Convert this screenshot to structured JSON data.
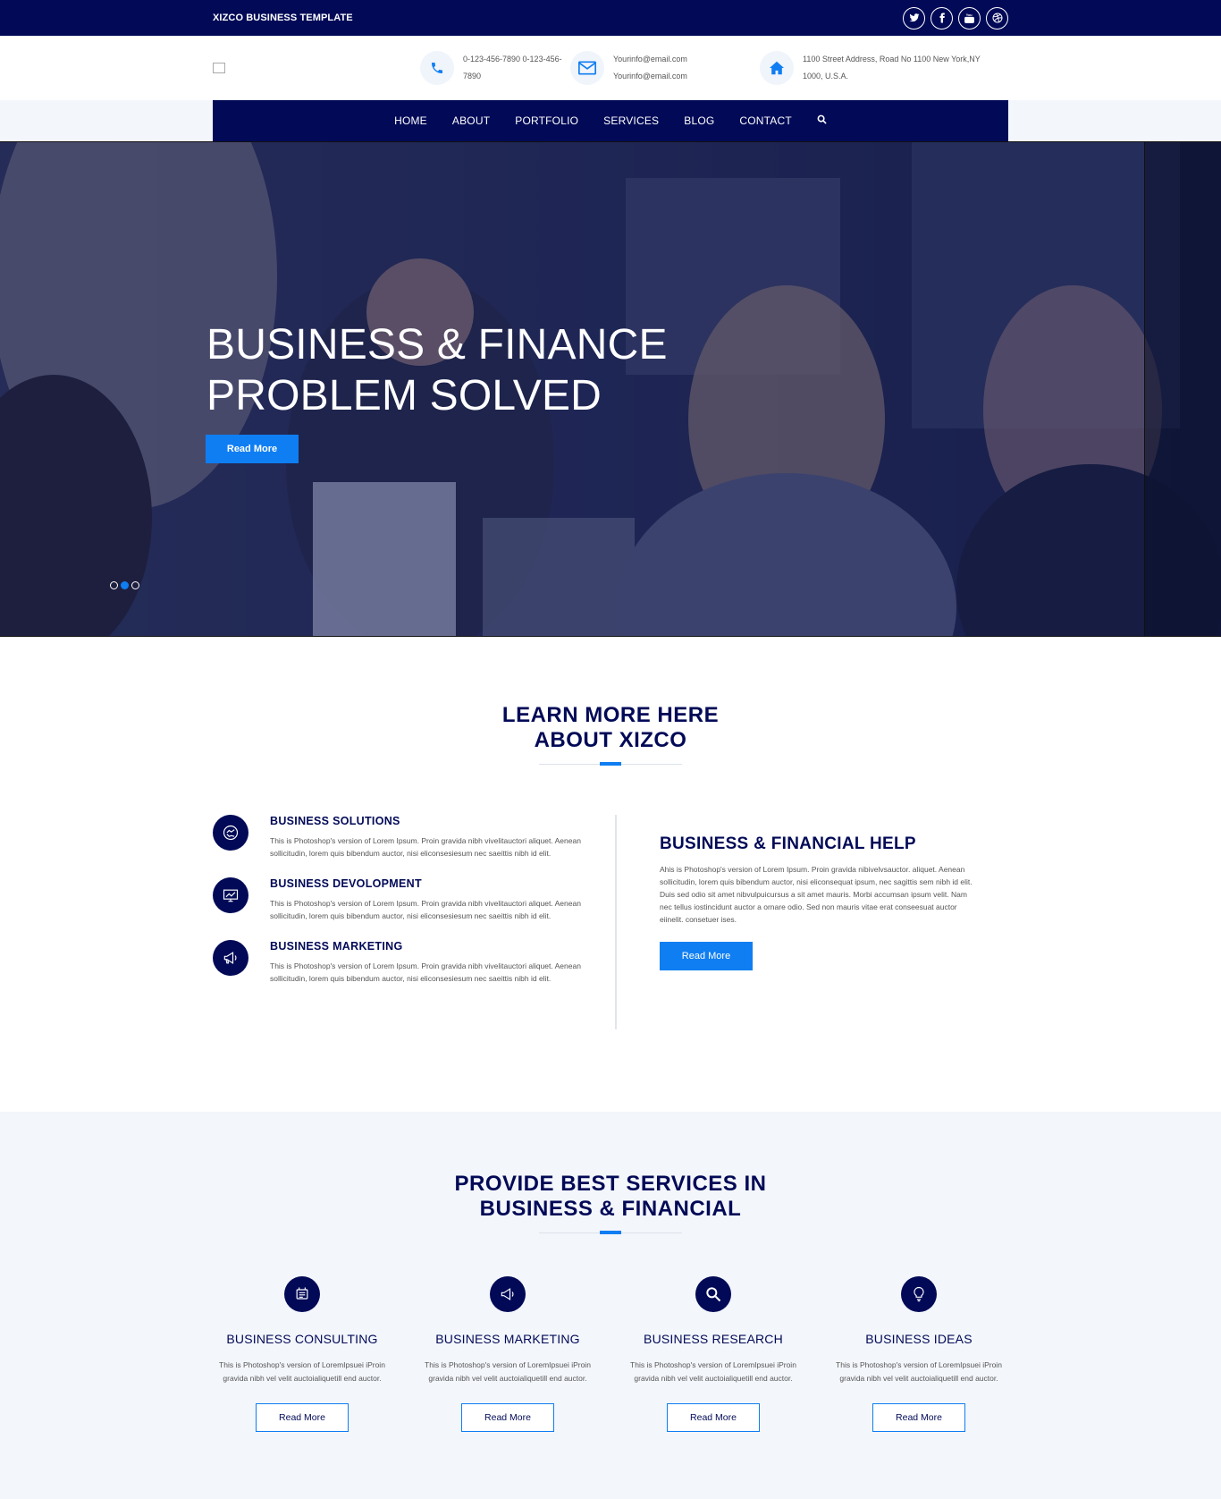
{
  "topbar": {
    "title": "XIZCO BUSINESS TEMPLATE",
    "socials": [
      "twitter-icon",
      "facebook-icon",
      "youtube-icon",
      "dribbble-icon"
    ]
  },
  "header": {
    "phone": "0-123-456-7890 0-123-456-7890",
    "email": "Yourinfo@email.com Yourinfo@email.com",
    "address": "1100 Street Address, Road No 1100 New York,NY 1000, U.S.A."
  },
  "nav": {
    "items": [
      "HOME",
      "ABOUT",
      "PORTFOLIO",
      "SERVICES",
      "BLOG",
      "CONTACT"
    ]
  },
  "hero": {
    "headline": "BUSINESS & FINANCE PROBLEM SOLVED",
    "button": "Read More",
    "slides": 3,
    "active_slide": 2
  },
  "about": {
    "title_line1": "LEARN MORE HERE",
    "title_line2": "ABOUT XIZCO",
    "features": [
      {
        "title": "BUSINESS SOLUTIONS",
        "desc": "This is Photoshop's version of Lorem Ipsum. Proin gravida nibh vivelitauctori aliquet. Aenean sollicitudin, lorem quis bibendum auctor, nisi eliconsesiesum nec saeittis nibh id elit."
      },
      {
        "title": "BUSINESS DEVOLOPMENT",
        "desc": "This is Photoshop's version of Lorem Ipsum. Proin gravida nibh vivelitauctori aliquet. Aenean sollicitudin, lorem quis bibendum auctor, nisi eliconsesiesum nec saeittis nibh id elit."
      },
      {
        "title": "BUSINESS MARKETING",
        "desc": "This is Photoshop's version of Lorem Ipsum. Proin gravida nibh vivelitauctori aliquet. Aenean sollicitudin, lorem quis bibendum auctor, nisi eliconsesiesum nec saeittis nibh id elit."
      }
    ],
    "help_title": "BUSINESS & FINANCIAL HELP",
    "help_desc": "Ahis is Photoshop's version of Lorem Ipsum. Proin gravida nibivelvsauctor. aliquet. Aenean sollicitudin, lorem quis bibendum auctor, nisi eliconsequat ipsum, nec sagittis sem nibh id elit. Duis sed odio sit amet nibvulpuicursus a sit amet mauris. Morbi accumsan ipsum velit. Nam nec tellus iostincidunt auctor a ornare odio. Sed non mauris vitae erat conseesuat auctor eiinelit. consetuer ises.",
    "help_button": "Read More"
  },
  "services": {
    "title_line1": "PROVIDE BEST SERVICES IN",
    "title_line2": "BUSINESS & FINANCIAL",
    "items": [
      {
        "title": "BUSINESS CONSULTING",
        "desc": "This is Photoshop's version of LoremIpsuei iProin gravida nibh vel velit auctoialiquetill end auctor.",
        "button": "Read More"
      },
      {
        "title": "BUSINESS MARKETING",
        "desc": "This is Photoshop's version of LoremIpsuei iProin gravida nibh vel velit auctoialiquetill end auctor.",
        "button": "Read More"
      },
      {
        "title": "BUSINESS RESEARCH",
        "desc": "This is Photoshop's version of LoremIpsuei iProin gravida nibh vel velit auctoialiquetill end auctor.",
        "button": "Read More"
      },
      {
        "title": "BUSINESS IDEAS",
        "desc": "This is Photoshop's version of LoremIpsuei iProin gravida nibh vel velit auctoialiquetill end auctor.",
        "button": "Read More"
      }
    ]
  },
  "colors": {
    "navy": "#020a57",
    "accent": "#0f7ef2",
    "light_bg": "#f3f6fb"
  }
}
